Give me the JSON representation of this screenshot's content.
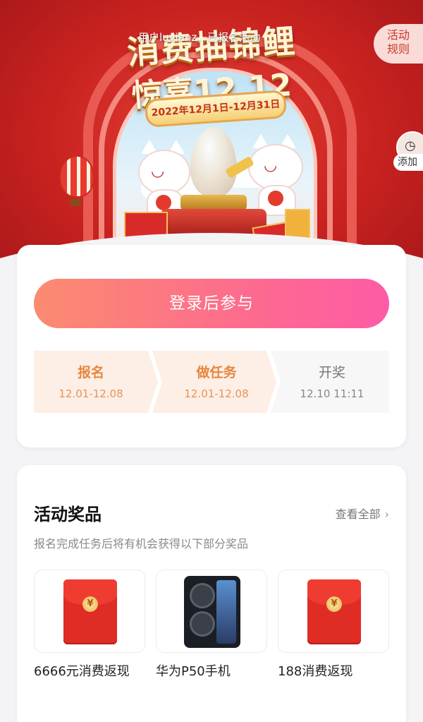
{
  "hero": {
    "user_status": "用户luvianz，已报名活动",
    "title_line1": "消费抽锦鲤",
    "title_line2": "惊喜12.12",
    "date_range": "2022年12月1日-12月31日"
  },
  "side": {
    "rules_line1": "活动",
    "rules_line2": "规则",
    "add_label": "添加"
  },
  "join": {
    "button_label": "登录后参与",
    "steps": [
      {
        "title": "报名",
        "date": "12.01-12.08"
      },
      {
        "title": "做任务",
        "date": "12.01-12.08"
      },
      {
        "title": "开奖",
        "date": "12.10 11:11"
      }
    ]
  },
  "prizes": {
    "title": "活动奖品",
    "more_label": "查看全部",
    "subtitle": "报名完成任务后将有机会获得以下部分奖品",
    "items": [
      {
        "name": "6666元消费返现",
        "icon": "red-envelope"
      },
      {
        "name": "华为P50手机",
        "icon": "phone"
      },
      {
        "name": "188消费返现",
        "icon": "red-envelope"
      }
    ]
  },
  "colors": {
    "hero_red": "#c8221f",
    "button_gradient_start": "#fb8b70",
    "button_gradient_end": "#fe5ba6",
    "step_active_text": "#e5863e"
  }
}
